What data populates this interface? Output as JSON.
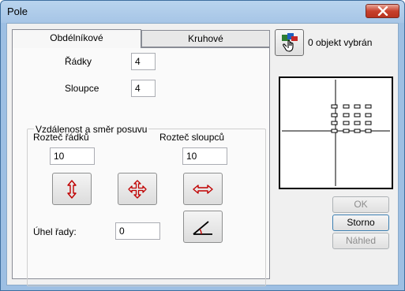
{
  "window": {
    "title": "Pole"
  },
  "tabs": [
    {
      "label": "Obdélníkové",
      "selected": true
    },
    {
      "label": "Kruhové",
      "selected": false
    }
  ],
  "rectangular": {
    "rows_label": "Řádky",
    "rows_value": "4",
    "columns_label": "Sloupce",
    "columns_value": "4",
    "group_caption": "Vzdálenost a směr posuvu",
    "row_spacing_label": "Rozteč řádků",
    "row_spacing_value": "10",
    "column_spacing_label": "Rozteč sloupců",
    "column_spacing_value": "10",
    "angle_label": "Úhel řady:",
    "angle_value": "0"
  },
  "selection": {
    "status_text": "0 objekt vybrán"
  },
  "buttons": {
    "ok": "OK",
    "cancel": "Storno",
    "preview": "Náhled"
  },
  "colors": {
    "icon_red": "#c00000",
    "accent_blue": "#1f5fbf"
  }
}
